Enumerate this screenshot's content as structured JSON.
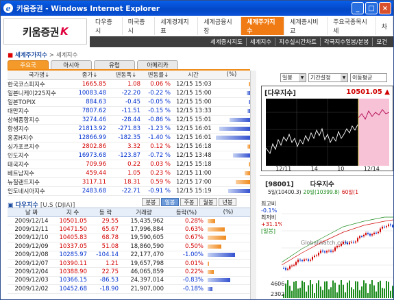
{
  "window": {
    "title": "키움증권 - Windows Internet Explorer",
    "buttons": [
      "_",
      "□",
      "×"
    ]
  },
  "header": {
    "logo_text": "키움증권",
    "logo_mark": "K",
    "top_nav": [
      "다우증시",
      "미국증시",
      "세계경제지표",
      "세계금융시장",
      "세계주가지수",
      "세계증시비교",
      "주요국종목시세",
      "차"
    ],
    "top_nav_active": 4,
    "sub_nav": [
      "세계증시지도",
      "세계지수",
      "지수실시간차트",
      "각국지수일봉/분봉",
      "모건"
    ]
  },
  "breadcrumb": {
    "main": "세계주가지수",
    "sub": "세계지수"
  },
  "region_tabs": [
    "주요국",
    "아시아",
    "유럽",
    "아메리카"
  ],
  "region_tabs_active": 0,
  "index_table": {
    "headers": [
      "국가명↓",
      "종가↓",
      "변동폭↓",
      "변동률↓",
      "시간",
      "(%)"
    ],
    "rows": [
      {
        "name": "한국코스피지수",
        "close": "1665.85",
        "chg": "1.08",
        "pct": "0.06 %",
        "time": "12/15 15:03",
        "dir": "up",
        "bar": 0.05
      },
      {
        "name": "일본니케이225지수",
        "close": "10083.48",
        "chg": "-22.20",
        "pct": "-0.22 %",
        "time": "12/15 15:00",
        "dir": "down",
        "bar": 0.1
      },
      {
        "name": "일본TOPIX",
        "close": "884.63",
        "chg": "-0.45",
        "pct": "-0.05 %",
        "time": "12/15 15:00",
        "dir": "down",
        "bar": 0.04
      },
      {
        "name": "대만지수",
        "close": "7807.62",
        "chg": "-11.51",
        "pct": "-0.15 %",
        "time": "12/15 13:33",
        "dir": "down",
        "bar": 0.08
      },
      {
        "name": "상해종합지수",
        "close": "3274.46",
        "chg": "-28.44",
        "pct": "-0.86 %",
        "time": "12/15 15:01",
        "dir": "down",
        "bar": 0.6
      },
      {
        "name": "항셍지수",
        "close": "21813.92",
        "chg": "-271.83",
        "pct": "-1.23 %",
        "time": "12/15 16:01",
        "dir": "down",
        "bar": 0.9
      },
      {
        "name": "홍콩H지수",
        "close": "12866.99",
        "chg": "-182.35",
        "pct": "-1.40 %",
        "time": "12/15 16:01",
        "dir": "down",
        "bar": 1.0
      },
      {
        "name": "싱가포르지수",
        "close": "2802.86",
        "chg": "3.32",
        "pct": "0.12 %",
        "time": "12/15 16:18",
        "dir": "up",
        "bar": 0.08
      },
      {
        "name": "인도지수",
        "close": "16973.68",
        "chg": "-123.87",
        "pct": "-0.72 %",
        "time": "12/15 13:48",
        "dir": "down",
        "bar": 0.5
      },
      {
        "name": "태국지수",
        "close": "709.96",
        "chg": "0.22",
        "pct": "0.03 %",
        "time": "12/15 15:18",
        "dir": "up",
        "bar": 0.03
      },
      {
        "name": "베트남지수",
        "close": "459.44",
        "chg": "1.05",
        "pct": "0.23 %",
        "time": "12/15 11:00",
        "dir": "up",
        "bar": 0.16
      },
      {
        "name": "뉴질랜드지수",
        "close": "3117.11",
        "chg": "18.31",
        "pct": "0.59 %",
        "time": "12/15 17:00",
        "dir": "up",
        "bar": 0.42
      },
      {
        "name": "인도네시아지수",
        "close": "2483.68",
        "chg": "-22.71",
        "pct": "-0.91 %",
        "time": "12/15 15:19",
        "dir": "down",
        "bar": 0.65
      }
    ]
  },
  "dow_section": {
    "title": "다우지수",
    "subtitle": "[U.S (DJIA)]",
    "period_tabs": [
      "분봉",
      "일봉",
      "주봉",
      "월봉",
      "년봉"
    ],
    "period_active": 1,
    "headers": [
      "날 짜",
      "지 수",
      "등 락",
      "거래량",
      "등락(%)",
      "(%)"
    ],
    "rows": [
      {
        "date": "2009/12/14",
        "idx": "10501.05",
        "chg": "29.55",
        "vol": "15,435,962",
        "pct": "0.28%",
        "dir": "up",
        "bar": 0.28
      },
      {
        "date": "2009/12/11",
        "idx": "10471.50",
        "chg": "65.67",
        "vol": "17,996,884",
        "pct": "0.63%",
        "dir": "up",
        "bar": 0.63
      },
      {
        "date": "2009/12/10",
        "idx": "10405.83",
        "chg": "68.78",
        "vol": "19,590,605",
        "pct": "0.67%",
        "dir": "up",
        "bar": 0.67
      },
      {
        "date": "2009/12/09",
        "idx": "10337.05",
        "chg": "51.08",
        "vol": "18,860,590",
        "pct": "0.50%",
        "dir": "up",
        "bar": 0.5
      },
      {
        "date": "2009/12/08",
        "idx": "10285.97",
        "chg": "-104.14",
        "vol": "22,177,470",
        "pct": "-1.00%",
        "dir": "down",
        "bar": 1.0
      },
      {
        "date": "2009/12/07",
        "idx": "10390.11",
        "chg": "1.21",
        "vol": "19,657,798",
        "pct": "0.01%",
        "dir": "up",
        "bar": 0.02
      },
      {
        "date": "2009/12/04",
        "idx": "10388.90",
        "chg": "22.75",
        "vol": "46,065,859",
        "pct": "0.22%",
        "dir": "up",
        "bar": 0.22
      },
      {
        "date": "2009/12/03",
        "idx": "10366.15",
        "chg": "-86.53",
        "vol": "24,397,014",
        "pct": "-0.83%",
        "dir": "down",
        "bar": 0.83
      },
      {
        "date": "2009/12/02",
        "idx": "10452.68",
        "chg": "-18.90",
        "vol": "21,907,000",
        "pct": "-0.18%",
        "dir": "down",
        "bar": 0.18
      }
    ]
  },
  "chart_controls": {
    "period": "일봉",
    "range": "기간설정",
    "ma": "이동평균"
  },
  "chart1": {
    "title": "[다우지수]",
    "value": "10501.05",
    "value_arrow": "▲",
    "x_labels": [
      "12/11",
      "14",
      "10",
      "12/14"
    ]
  },
  "chart2": {
    "code": "[98001]",
    "title": "다우지수",
    "legend": [
      {
        "text": "5일(10400.3)",
        "color": "#222222"
      },
      {
        "text": "20일(10399.8)",
        "color": "#1a8a1a"
      },
      {
        "text": "60일(1",
        "color": "#d00000"
      }
    ],
    "side": [
      {
        "label": "최고비",
        "value": "-0.1%",
        "kind": "b"
      },
      {
        "label": "최저비",
        "value": "+31.1%",
        "kind": "r"
      },
      {
        "label": "[일봉]",
        "value": "",
        "kind": "g"
      }
    ],
    "volume_labels": [
      "4606",
      "2302"
    ],
    "watermark": "GlobalWatch.co.kr",
    "x_labels": [
      "7",
      "8",
      "9",
      "10",
      "11",
      "12"
    ]
  }
}
